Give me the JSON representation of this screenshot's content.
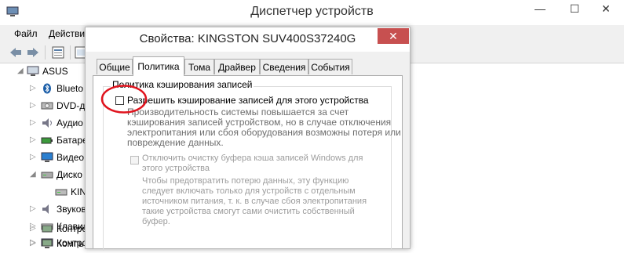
{
  "device_manager": {
    "title": "Диспетчер устройств",
    "menu": [
      "Файл",
      "Действи"
    ],
    "window_controls": {
      "minimize": "—",
      "maximize": "☐",
      "close": "✕"
    },
    "tree": {
      "root": "ASUS",
      "items": [
        {
          "label": "Blueto",
          "icon": "bluetooth-icon"
        },
        {
          "label": "DVD-д",
          "icon": "dvd-drive-icon"
        },
        {
          "label": "Аудио",
          "icon": "audio-icon"
        },
        {
          "label": "Батаре",
          "icon": "battery-icon"
        },
        {
          "label": "Видео",
          "icon": "display-adapter-icon"
        },
        {
          "label": "Диско",
          "icon": "disk-drive-icon"
        },
        {
          "label": "KIN",
          "icon": "disk-device-icon"
        },
        {
          "label": "Звуков",
          "icon": "sound-icon"
        },
        {
          "label": "Клавиа",
          "icon": "keyboard-icon"
        },
        {
          "label": "Компь",
          "icon": "computer-icon"
        },
        {
          "label": "Контро",
          "icon": "controller-icon"
        },
        {
          "label": "Контро",
          "icon": "controller-icon"
        }
      ]
    }
  },
  "dialog": {
    "title": "Свойства: KINGSTON SUV400S37240G",
    "close": "✕",
    "tabs": [
      "Общие",
      "Политика",
      "Тома",
      "Драйвер",
      "Сведения",
      "События"
    ],
    "active_tab": "Политика",
    "group_title": "Политика кэширования записей",
    "enable_caching": {
      "label": "Разрешить кэширование записей для этого устройства",
      "checked": false,
      "description": [
        "Производительность системы повышается за счет",
        "кэширования записей устройством, но в случае отключения",
        "электропитания или сбоя оборудования возможны потеря или",
        "повреждение данных."
      ]
    },
    "disable_flush": {
      "label": [
        "Отключить очистку буфера кэша записей Windows для",
        "этого устройства"
      ],
      "checked": false,
      "enabled": false,
      "description": [
        "Чтобы предотвратить потерю данных, эту функцию",
        "следует включать только для устройств с отдельным",
        "источником питания, т. к. в случае сбоя электропитания",
        "такие устройства смогут сами очистить собственный",
        "буфер."
      ]
    }
  },
  "colors": {
    "annotation_ellipse": "#e0141e",
    "close_button": "#c75050"
  }
}
